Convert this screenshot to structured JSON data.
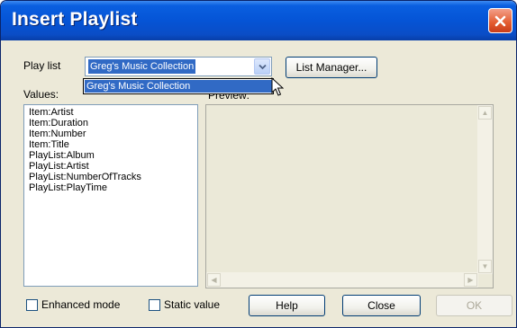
{
  "window": {
    "title": "Insert Playlist"
  },
  "playlist": {
    "label": "Play list",
    "selected": "Greg's Music Collection",
    "options": [
      "Greg's Music Collection"
    ]
  },
  "buttons": {
    "list_manager": "List Manager...",
    "help": "Help",
    "close": "Close",
    "ok": "OK"
  },
  "values": {
    "label": "Values:",
    "items": [
      "Item:Artist",
      "Item:Duration",
      "Item:Number",
      "Item:Title",
      "PlayList:Album",
      "PlayList:Artist",
      "PlayList:NumberOfTracks",
      "PlayList:PlayTime"
    ]
  },
  "preview": {
    "label": "Preview:"
  },
  "options": {
    "enhanced_mode": "Enhanced mode",
    "static_value": "Static value"
  },
  "icons": {
    "close": "close-icon",
    "dropdown": "chevron-down-icon",
    "cursor": "mouse-pointer-icon"
  },
  "colors": {
    "title_bar": "#0554d6",
    "selection": "#316ac5",
    "close_button": "#e35b2f",
    "dialog_bg": "#ece9d8"
  }
}
